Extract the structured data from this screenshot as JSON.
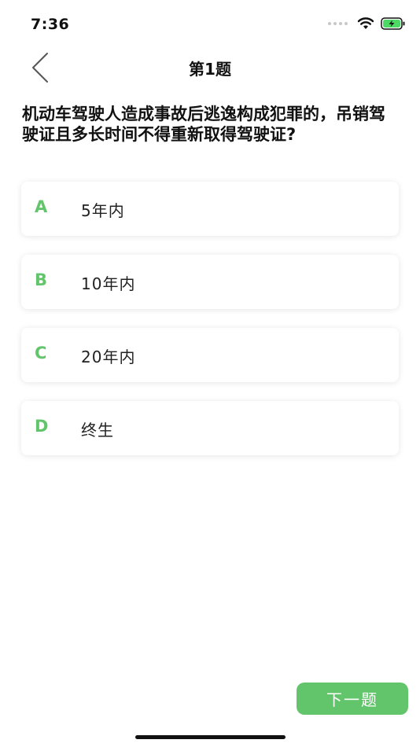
{
  "status_bar": {
    "time": "7:36",
    "icons": [
      "signal-dots-icon",
      "wifi-icon",
      "battery-charging-icon"
    ]
  },
  "nav": {
    "back_icon": "chevron-left-icon",
    "title": "第1题"
  },
  "question": {
    "text": "机动车驾驶人造成事故后逃逸构成犯罪的，吊销驾驶证且多长时间不得重新取得驾驶证?"
  },
  "options": [
    {
      "letter": "A",
      "text": "5年内"
    },
    {
      "letter": "B",
      "text": "10年内"
    },
    {
      "letter": "C",
      "text": "20年内"
    },
    {
      "letter": "D",
      "text": "终生"
    }
  ],
  "next_button": {
    "label": "下一题"
  },
  "colors": {
    "accent": "#63c56b",
    "battery": "#4cd964"
  }
}
